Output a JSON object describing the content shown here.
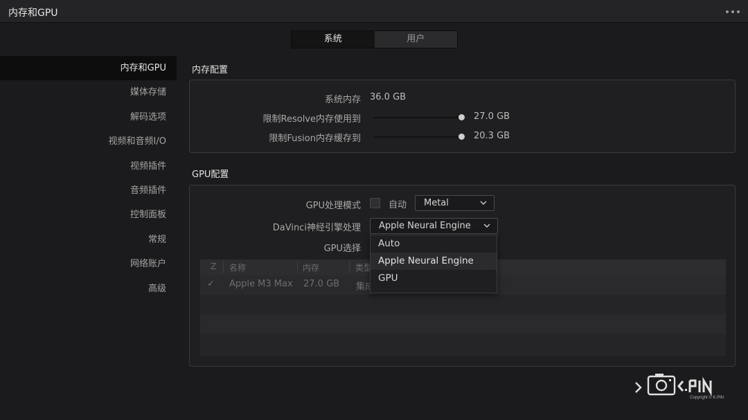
{
  "window": {
    "title": "内存和GPU"
  },
  "tabs": [
    {
      "label": "系统",
      "active": true
    },
    {
      "label": "用户",
      "active": false
    }
  ],
  "sidebar": {
    "items": [
      {
        "label": "内存和GPU",
        "active": true
      },
      {
        "label": "媒体存储"
      },
      {
        "label": "解码选项"
      },
      {
        "label": "视频和音频I/O"
      },
      {
        "label": "视频插件"
      },
      {
        "label": "音频插件"
      },
      {
        "label": "控制面板"
      },
      {
        "label": "常规"
      },
      {
        "label": "网络账户"
      },
      {
        "label": "高级"
      }
    ]
  },
  "memory": {
    "section_title": "内存配置",
    "system_memory_label": "系统内存",
    "system_memory_value": "36.0 GB",
    "resolve_limit_label": "限制Resolve内存使用到",
    "resolve_limit_value": "27.0 GB",
    "resolve_limit_fraction": 1.0,
    "fusion_limit_label": "限制Fusion内存缓存到",
    "fusion_limit_value": "20.3 GB",
    "fusion_limit_fraction": 1.0
  },
  "gpu": {
    "section_title": "GPU配置",
    "mode_label": "GPU处理模式",
    "auto_checkbox_label": "自动",
    "auto_checked": false,
    "mode_value": "Metal",
    "neural_label": "DaVinci神经引擎处理",
    "neural_value": "Apple Neural Engine",
    "select_label": "GPU选择",
    "table": {
      "headers": [
        "Z",
        "名称",
        "内存",
        "类型"
      ],
      "rows": [
        {
          "check": "✓",
          "name": "Apple M3 Max",
          "memory": "27.0 GB",
          "type": "集成"
        }
      ]
    }
  },
  "neural_dropdown_menu": {
    "options": [
      "Auto",
      "Apple Neural Engine",
      "GPU"
    ],
    "highlighted_index": 1
  },
  "watermark": {
    "text": "K.PIN",
    "copyright": "Copyright © K.PIN"
  },
  "colors": {
    "background": "#1b1b1d",
    "panel": "#1f1f21",
    "accent_text": "#e4e4e4"
  }
}
